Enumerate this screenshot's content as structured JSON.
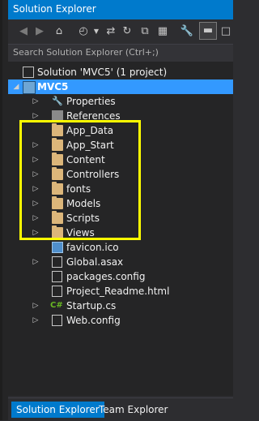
{
  "colors": {
    "accent": "#007acc",
    "selection": "#3399ff",
    "highlight": "#ffff00",
    "tree_bg": "#252526",
    "panel_bg": "#2d2d30"
  },
  "window": {
    "title": "Solution Explorer"
  },
  "search": {
    "placeholder": "Search Solution Explorer (Ctrl+;)"
  },
  "toolbar": {
    "icons": [
      "back-icon",
      "forward-icon",
      "home-icon",
      "history-icon",
      "sync-icon",
      "collapse-all-icon",
      "show-all-files-icon",
      "properties-icon",
      "preview-icon"
    ]
  },
  "tree": {
    "solution": "Solution 'MVC5' (1 project)",
    "project": "MVC5",
    "items": [
      "Properties",
      "References",
      "App_Data",
      "App_Start",
      "Content",
      "Controllers",
      "fonts",
      "Models",
      "Scripts",
      "Views",
      "favicon.ico",
      "Global.asax",
      "packages.config",
      "Project_Readme.html",
      "Startup.cs",
      "Web.config"
    ]
  },
  "tabs": [
    "Solution Explorer",
    "Team Explorer"
  ]
}
